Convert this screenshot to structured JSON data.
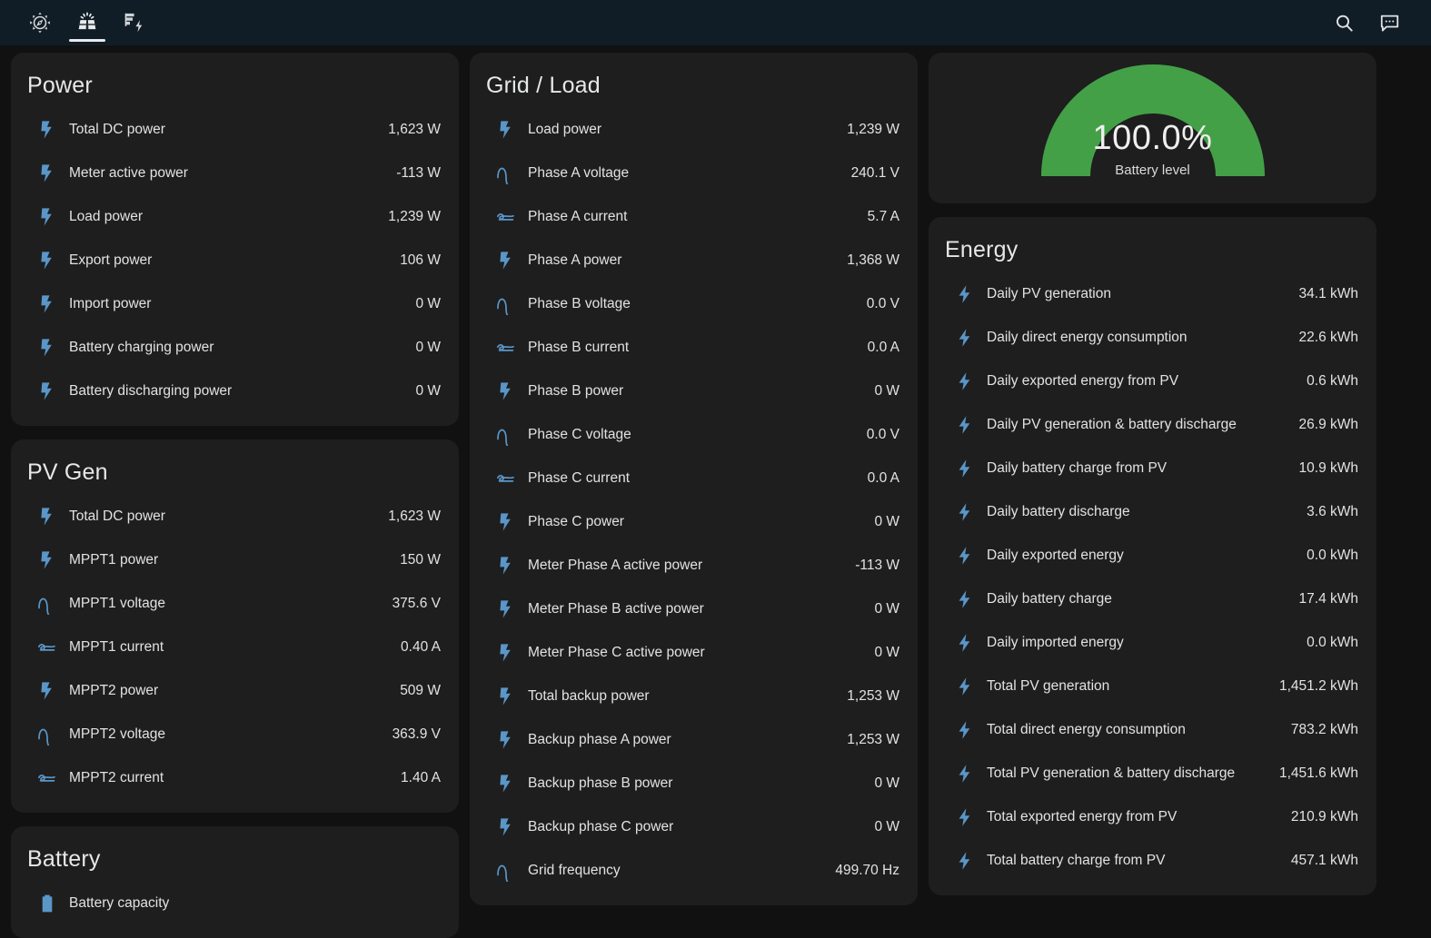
{
  "topbar": {
    "tabs": [
      {
        "name": "weather-tab",
        "icon": "compass-icon",
        "active": false
      },
      {
        "name": "solar-tab",
        "icon": "solar-panel-icon",
        "active": true
      },
      {
        "name": "energy-tab",
        "icon": "flash-alert-icon",
        "active": false
      }
    ],
    "actions": [
      {
        "name": "search-button",
        "icon": "search-icon"
      },
      {
        "name": "assist-button",
        "icon": "chat-bubble-icon"
      }
    ]
  },
  "colors": {
    "topbar_bg": "#101d26",
    "page_bg": "#111111",
    "card_bg": "#1e1e1e",
    "icon_blue": "#5a96c8",
    "gauge_green": "#43a047",
    "text": "#e1e2e4"
  },
  "cards": {
    "power": {
      "title": "Power",
      "rows": [
        {
          "icon": "lightning-bolt-icon",
          "name": "Total DC power",
          "value": "1,623 W"
        },
        {
          "icon": "lightning-bolt-icon",
          "name": "Meter active power",
          "value": "-113 W"
        },
        {
          "icon": "lightning-bolt-icon",
          "name": "Load power",
          "value": "1,239 W"
        },
        {
          "icon": "lightning-bolt-icon",
          "name": "Export power",
          "value": "106 W"
        },
        {
          "icon": "lightning-bolt-icon",
          "name": "Import power",
          "value": "0 W"
        },
        {
          "icon": "lightning-bolt-icon",
          "name": "Battery charging power",
          "value": "0 W"
        },
        {
          "icon": "lightning-bolt-icon",
          "name": "Battery discharging power",
          "value": "0 W"
        }
      ]
    },
    "pv_gen": {
      "title": "PV Gen",
      "rows": [
        {
          "icon": "lightning-bolt-icon",
          "name": "Total DC power",
          "value": "1,623 W"
        },
        {
          "icon": "lightning-bolt-icon",
          "name": "MPPT1 power",
          "value": "150 W"
        },
        {
          "icon": "sine-wave-icon",
          "name": "MPPT1 voltage",
          "value": "375.6 V"
        },
        {
          "icon": "current-ac-icon",
          "name": "MPPT1 current",
          "value": "0.40 A"
        },
        {
          "icon": "lightning-bolt-icon",
          "name": "MPPT2 power",
          "value": "509 W"
        },
        {
          "icon": "sine-wave-icon",
          "name": "MPPT2 voltage",
          "value": "363.9 V"
        },
        {
          "icon": "current-ac-icon",
          "name": "MPPT2 current",
          "value": "1.40 A"
        }
      ]
    },
    "battery": {
      "title": "Battery",
      "rows": [
        {
          "icon": "battery-icon",
          "name": "Battery capacity",
          "value": ""
        }
      ]
    },
    "grid_load": {
      "title": "Grid / Load",
      "rows": [
        {
          "icon": "lightning-bolt-icon",
          "name": "Load power",
          "value": "1,239 W"
        },
        {
          "icon": "sine-wave-icon",
          "name": "Phase A voltage",
          "value": "240.1 V"
        },
        {
          "icon": "current-ac-icon",
          "name": "Phase A current",
          "value": "5.7 A"
        },
        {
          "icon": "lightning-bolt-icon",
          "name": "Phase A power",
          "value": "1,368 W"
        },
        {
          "icon": "sine-wave-icon",
          "name": "Phase B voltage",
          "value": "0.0 V"
        },
        {
          "icon": "current-ac-icon",
          "name": "Phase B current",
          "value": "0.0 A"
        },
        {
          "icon": "lightning-bolt-icon",
          "name": "Phase B power",
          "value": "0 W"
        },
        {
          "icon": "sine-wave-icon",
          "name": "Phase C voltage",
          "value": "0.0 V"
        },
        {
          "icon": "current-ac-icon",
          "name": "Phase C current",
          "value": "0.0 A"
        },
        {
          "icon": "lightning-bolt-icon",
          "name": "Phase C power",
          "value": "0 W"
        },
        {
          "icon": "lightning-bolt-icon",
          "name": "Meter Phase A active power",
          "value": "-113 W"
        },
        {
          "icon": "lightning-bolt-icon",
          "name": "Meter Phase B active power",
          "value": "0 W"
        },
        {
          "icon": "lightning-bolt-icon",
          "name": "Meter Phase C active power",
          "value": "0 W"
        },
        {
          "icon": "lightning-bolt-icon",
          "name": "Total backup power",
          "value": "1,253 W"
        },
        {
          "icon": "lightning-bolt-icon",
          "name": "Backup phase A power",
          "value": "1,253 W"
        },
        {
          "icon": "lightning-bolt-icon",
          "name": "Backup phase B power",
          "value": "0 W"
        },
        {
          "icon": "lightning-bolt-icon",
          "name": "Backup phase C power",
          "value": "0 W"
        },
        {
          "icon": "sine-wave-icon",
          "name": "Grid frequency",
          "value": "499.70 Hz"
        }
      ]
    },
    "battery_gauge": {
      "value": "100.0%",
      "label": "Battery level",
      "percent": 100
    },
    "energy": {
      "title": "Energy",
      "rows": [
        {
          "icon": "flash-icon",
          "name": "Daily PV generation",
          "value": "34.1 kWh"
        },
        {
          "icon": "flash-icon",
          "name": "Daily direct energy consumption",
          "value": "22.6 kWh"
        },
        {
          "icon": "flash-icon",
          "name": "Daily exported energy from PV",
          "value": "0.6 kWh"
        },
        {
          "icon": "flash-icon",
          "name": "Daily PV generation & battery discharge",
          "value": "26.9 kWh"
        },
        {
          "icon": "flash-icon",
          "name": "Daily battery charge from PV",
          "value": "10.9 kWh"
        },
        {
          "icon": "flash-icon",
          "name": "Daily battery discharge",
          "value": "3.6 kWh"
        },
        {
          "icon": "flash-icon",
          "name": "Daily exported energy",
          "value": "0.0 kWh"
        },
        {
          "icon": "flash-icon",
          "name": "Daily battery charge",
          "value": "17.4 kWh"
        },
        {
          "icon": "flash-icon",
          "name": "Daily imported energy",
          "value": "0.0 kWh"
        },
        {
          "icon": "flash-icon",
          "name": "Total PV generation",
          "value": "1,451.2 kWh"
        },
        {
          "icon": "flash-icon",
          "name": "Total direct energy consumption",
          "value": "783.2 kWh"
        },
        {
          "icon": "flash-icon",
          "name": "Total PV generation & battery discharge",
          "value": "1,451.6 kWh"
        },
        {
          "icon": "flash-icon",
          "name": "Total exported energy from PV",
          "value": "210.9 kWh"
        },
        {
          "icon": "flash-icon",
          "name": "Total battery charge from PV",
          "value": "457.1 kWh"
        }
      ]
    }
  }
}
